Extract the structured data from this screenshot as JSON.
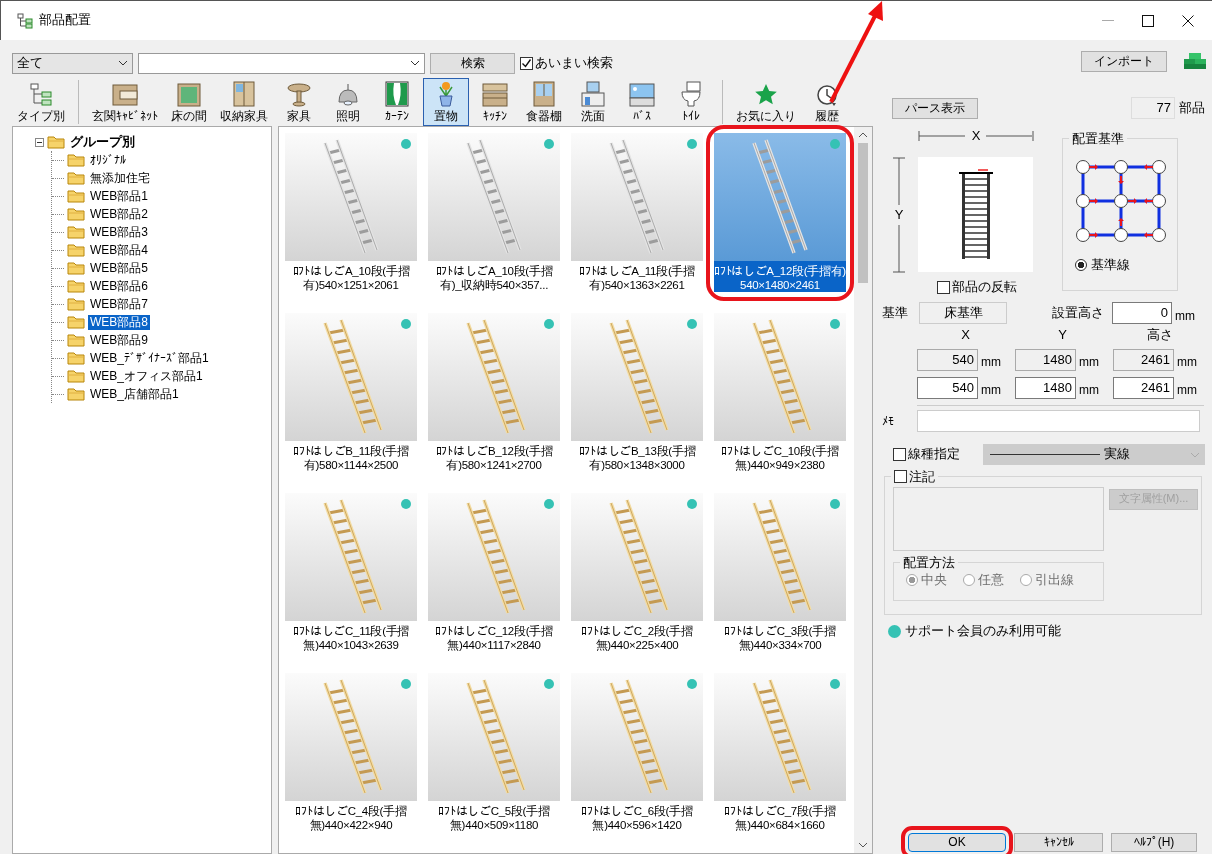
{
  "window": {
    "title": "部品配置",
    "pointer_arrow": true
  },
  "search": {
    "category": "全て",
    "search_button": "検索",
    "fuzzy": {
      "label": "あいまい検索",
      "checked": true
    }
  },
  "import_button": "インポート",
  "toolbar": [
    [
      {
        "label": "タイプ別",
        "selected": false
      }
    ],
    [
      {
        "label": "玄関ｷｬﾋﾞﾈｯﾄ",
        "selected": false
      },
      {
        "label": "床の間",
        "selected": false
      },
      {
        "label": "収納家具",
        "selected": false
      },
      {
        "label": "家具",
        "selected": false
      },
      {
        "label": "照明",
        "selected": false
      },
      {
        "label": "ｶｰﾃﾝ",
        "selected": false
      },
      {
        "label": "置物",
        "selected": true
      },
      {
        "label": "ｷｯﾁﾝ",
        "selected": false
      },
      {
        "label": "食器棚",
        "selected": false
      },
      {
        "label": "洗面",
        "selected": false
      },
      {
        "label": "ﾊﾞｽ",
        "selected": false
      },
      {
        "label": "ﾄｲﾚ",
        "selected": false
      }
    ],
    [
      {
        "label": "お気に入り",
        "selected": false
      },
      {
        "label": "履歴",
        "selected": false
      }
    ]
  ],
  "perspective_button": "パース表示",
  "count": {
    "value": "77",
    "unit": "部品"
  },
  "tree": {
    "label": "グループ別",
    "expanded": true,
    "children": [
      {
        "label": "ｵﾘｼﾞﾅﾙ",
        "selected": false
      },
      {
        "label": "無添加住宅",
        "selected": false
      },
      {
        "label": "WEB部品1",
        "selected": false
      },
      {
        "label": "WEB部品2",
        "selected": false
      },
      {
        "label": "WEB部品3",
        "selected": false
      },
      {
        "label": "WEB部品4",
        "selected": false
      },
      {
        "label": "WEB部品5",
        "selected": false
      },
      {
        "label": "WEB部品6",
        "selected": false
      },
      {
        "label": "WEB部品7",
        "selected": false
      },
      {
        "label": "WEB部品8",
        "selected": true
      },
      {
        "label": "WEB部品9",
        "selected": false
      },
      {
        "label": "WEB_ﾃﾞｻﾞｲﾅｰｽﾞ部品1",
        "selected": false
      },
      {
        "label": "WEB_オフィス部品1",
        "selected": false
      },
      {
        "label": "WEB_店舗部品1",
        "selected": false
      }
    ]
  },
  "items": [
    {
      "name": "ﾛﾌﾄはしごA_10段(手摺有)",
      "size": "540×1251×2061",
      "kind": "metal",
      "member_only": true,
      "selected": false,
      "highlighted": false
    },
    {
      "name": "ﾛﾌﾄはしごA_10段(手摺有)_収納時",
      "size": "540×357...",
      "kind": "metal",
      "member_only": true,
      "selected": false,
      "highlighted": false
    },
    {
      "name": "ﾛﾌﾄはしごA_11段(手摺有)",
      "size": "540×1363×2261",
      "kind": "metal",
      "member_only": true,
      "selected": false,
      "highlighted": false
    },
    {
      "name": "ﾛﾌﾄはしごA_12段(手摺有)",
      "size": "540×1480×2461",
      "kind": "metal",
      "member_only": true,
      "selected": true,
      "highlighted": true
    },
    {
      "name": "ﾛﾌﾄはしごB_11段(手摺有)",
      "size": "580×1144×2500",
      "kind": "wood",
      "member_only": true,
      "selected": false,
      "highlighted": false
    },
    {
      "name": "ﾛﾌﾄはしごB_12段(手摺有)",
      "size": "580×1241×2700",
      "kind": "wood",
      "member_only": true,
      "selected": false,
      "highlighted": false
    },
    {
      "name": "ﾛﾌﾄはしごB_13段(手摺有)",
      "size": "580×1348×3000",
      "kind": "wood",
      "member_only": true,
      "selected": false,
      "highlighted": false
    },
    {
      "name": "ﾛﾌﾄはしごC_10段(手摺無)",
      "size": "440×949×2380",
      "kind": "wood",
      "member_only": true,
      "selected": false,
      "highlighted": false
    },
    {
      "name": "ﾛﾌﾄはしごC_11段(手摺無)",
      "size": "440×1043×2639",
      "kind": "wood",
      "member_only": true,
      "selected": false,
      "highlighted": false
    },
    {
      "name": "ﾛﾌﾄはしごC_12段(手摺無)",
      "size": "440×1117×2840",
      "kind": "wood",
      "member_only": true,
      "selected": false,
      "highlighted": false
    },
    {
      "name": "ﾛﾌﾄはしごC_2段(手摺無)",
      "size": "440×225×400",
      "kind": "wood",
      "member_only": true,
      "selected": false,
      "highlighted": false
    },
    {
      "name": "ﾛﾌﾄはしごC_3段(手摺無)",
      "size": "440×334×700",
      "kind": "wood",
      "member_only": true,
      "selected": false,
      "highlighted": false
    },
    {
      "name": "ﾛﾌﾄはしごC_4段(手摺無)",
      "size": "440×422×940",
      "kind": "wood",
      "member_only": true,
      "selected": false,
      "highlighted": false
    },
    {
      "name": "ﾛﾌﾄはしごC_5段(手摺無)",
      "size": "440×509×1180",
      "kind": "wood",
      "member_only": true,
      "selected": false,
      "highlighted": false
    },
    {
      "name": "ﾛﾌﾄはしごC_6段(手摺無)",
      "size": "440×596×1420",
      "kind": "wood",
      "member_only": true,
      "selected": false,
      "highlighted": false
    },
    {
      "name": "ﾛﾌﾄはしごC_7段(手摺無)",
      "size": "440×684×1660",
      "kind": "wood",
      "member_only": true,
      "selected": false,
      "highlighted": false
    }
  ],
  "details": {
    "dimension_labels": {
      "x": "X",
      "y": "Y"
    },
    "flip": {
      "label": "部品の反転",
      "checked": false
    },
    "anchor": {
      "title": "配置基準",
      "option": {
        "label": "基準線",
        "selected": true
      }
    },
    "base": {
      "label": "基準",
      "value": "床基準"
    },
    "install_height": {
      "label": "設置高さ",
      "value": "0",
      "unit": "mm"
    },
    "size_headers": [
      "X",
      "Y",
      "高さ"
    ],
    "size_rows": [
      {
        "readonly": true,
        "cells": [
          {
            "value": "540",
            "unit": "mm"
          },
          {
            "value": "1480",
            "unit": "mm"
          },
          {
            "value": "2461",
            "unit": "mm"
          }
        ]
      },
      {
        "readonly": false,
        "cells": [
          {
            "value": "540",
            "unit": "mm"
          },
          {
            "value": "1480",
            "unit": "mm"
          },
          {
            "value": "2461",
            "unit": "mm"
          }
        ]
      }
    ],
    "memo": {
      "label": "ﾒﾓ"
    },
    "line_type": {
      "label": "線種指定",
      "checked": false,
      "value": "実線",
      "disabled": true
    },
    "note": {
      "label": "注記",
      "checked": false,
      "font_button": {
        "label": "文字属性(M)...",
        "disabled": true
      },
      "placement": {
        "title": "配置方法",
        "disabled": true,
        "options": [
          {
            "label": "中央",
            "selected": true
          },
          {
            "label": "任意",
            "selected": false
          },
          {
            "label": "引出線",
            "selected": false
          }
        ]
      }
    }
  },
  "support_legend": "サポート会員のみ利用可能",
  "buttons": [
    {
      "label": "OK",
      "highlighted": true
    },
    {
      "label": "ｷｬﾝｾﾙ",
      "highlighted": false
    },
    {
      "label": "ﾍﾙﾌﾟ(H)",
      "highlighted": false
    }
  ]
}
